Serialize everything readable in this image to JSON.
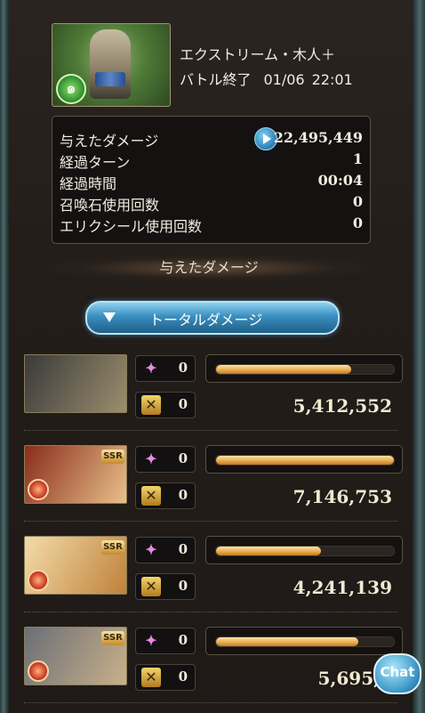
{
  "header": {
    "boss_name": "エクストリーム・木人＋",
    "battle_status": "バトル終了",
    "date": "01/06",
    "time": "22:01"
  },
  "summary": {
    "rows": [
      {
        "label": "与えたダメージ",
        "value": "22,495,449"
      },
      {
        "label": "経過ターン",
        "value": "1"
      },
      {
        "label": "経過時間",
        "value": "00:04"
      },
      {
        "label": "召喚石使用回数",
        "value": "0"
      },
      {
        "label": "エリクシール使用回数",
        "value": "0"
      }
    ]
  },
  "section_title": "与えたダメージ",
  "tab_button": "トータルダメージ",
  "characters": [
    {
      "skills": "0",
      "ca": "0",
      "damage": "5,412,552",
      "bar": 0.76,
      "ssr": false,
      "colors": [
        "#3a3a3a",
        "#9b8e6e"
      ]
    },
    {
      "skills": "0",
      "ca": "0",
      "damage": "7,146,753",
      "bar": 1.0,
      "ssr": true,
      "colors": [
        "#8a2c1c",
        "#e8c08a"
      ]
    },
    {
      "skills": "0",
      "ca": "0",
      "damage": "4,241,139",
      "bar": 0.59,
      "ssr": true,
      "colors": [
        "#f2dca8",
        "#c0813b"
      ]
    },
    {
      "skills": "0",
      "ca": "0",
      "damage": "5,695,0",
      "bar": 0.8,
      "ssr": true,
      "colors": [
        "#6b6f77",
        "#c9b08a"
      ]
    }
  ],
  "ssr_label": "SSR",
  "chat_label": "Chat",
  "icons": {
    "skill": "spark-icon",
    "ca": "charge-attack-icon",
    "play": "play-icon",
    "element": "wind-element-icon"
  }
}
